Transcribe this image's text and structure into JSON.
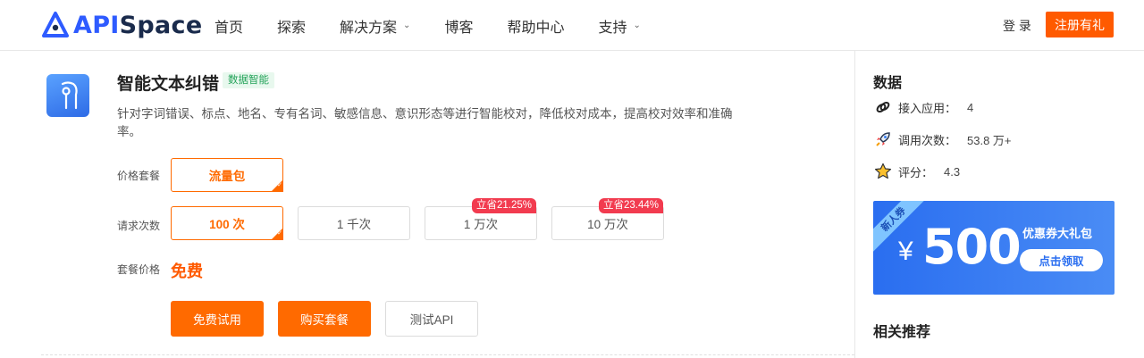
{
  "header": {
    "logo_api": "API",
    "logo_space": "Space",
    "nav": [
      {
        "label": "首页",
        "has_dropdown": false
      },
      {
        "label": "探索",
        "has_dropdown": false
      },
      {
        "label": "解决方案",
        "has_dropdown": true
      },
      {
        "label": "博客",
        "has_dropdown": false
      },
      {
        "label": "帮助中心",
        "has_dropdown": false
      },
      {
        "label": "支持",
        "has_dropdown": true
      }
    ],
    "login": "登 录",
    "register": "注册有礼"
  },
  "product": {
    "title": "智能文本纠错",
    "tag": "数据智能",
    "description": "针对字词错误、标点、地名、专有名词、敏感信息、意识形态等进行智能校对，降低校对成本，提高校对效率和准确率。",
    "package_label": "价格套餐",
    "package_option": "流量包",
    "requests_label": "请求次数",
    "request_options": [
      {
        "label": "100 次",
        "badge": "",
        "selected": true
      },
      {
        "label": "1 千次",
        "badge": "",
        "selected": false
      },
      {
        "label": "1 万次",
        "badge": "立省21.25%",
        "selected": false
      },
      {
        "label": "10 万次",
        "badge": "立省23.44%",
        "selected": false
      }
    ],
    "price_label": "套餐价格",
    "price": "免费",
    "buttons": {
      "trial": "免费试用",
      "buy": "购买套餐",
      "test": "测试API"
    }
  },
  "sidebar": {
    "data_title": "数据",
    "stats": [
      {
        "label": "接入应用：",
        "value": "4",
        "icon": "link-icon"
      },
      {
        "label": "调用次数：",
        "value": "53.8 万+",
        "icon": "rocket-icon"
      },
      {
        "label": "评分：",
        "value": "4.3",
        "icon": "star-icon"
      }
    ],
    "coupon": {
      "ribbon": "新人券",
      "currency": "¥",
      "amount": "500",
      "name": "优惠券大礼包",
      "button": "点击领取"
    },
    "recommend_title": "相关推荐"
  },
  "colors": {
    "brand_orange": "#ff6a00",
    "brand_blue": "#2e5bff",
    "badge_red": "#f23b4f",
    "tag_green": "#25a35a"
  }
}
